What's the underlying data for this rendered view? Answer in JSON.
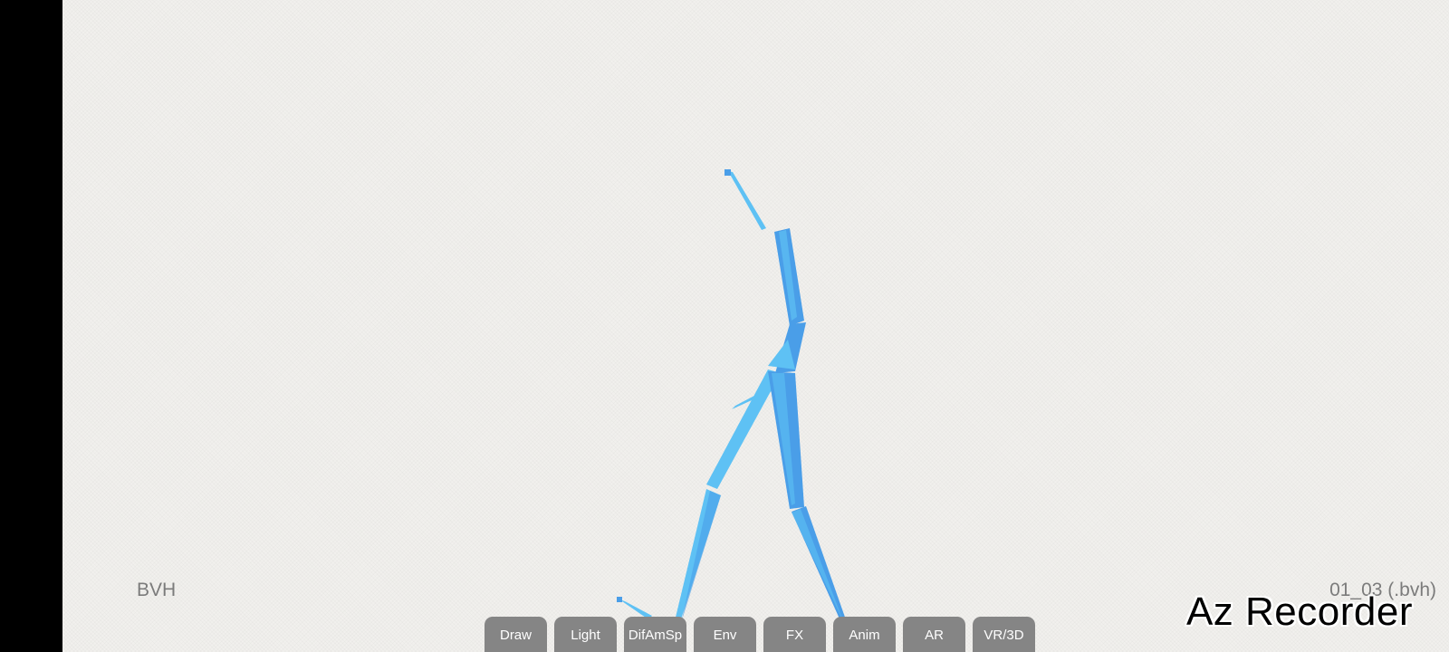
{
  "viewer": {
    "mode_label": "BVH",
    "file_label": "01_03 (.bvh)"
  },
  "toolbar": {
    "buttons": [
      "Draw",
      "Light",
      "DifAmSp",
      "Env",
      "FX",
      "Anim",
      "AR",
      "VR/3D"
    ]
  },
  "watermark": {
    "text": "Az Recorder"
  },
  "colors": {
    "background": "#f1f0ed",
    "bone_light": "#5ec1f4",
    "bone_dark": "#4a9ee8",
    "button": "#858585"
  }
}
